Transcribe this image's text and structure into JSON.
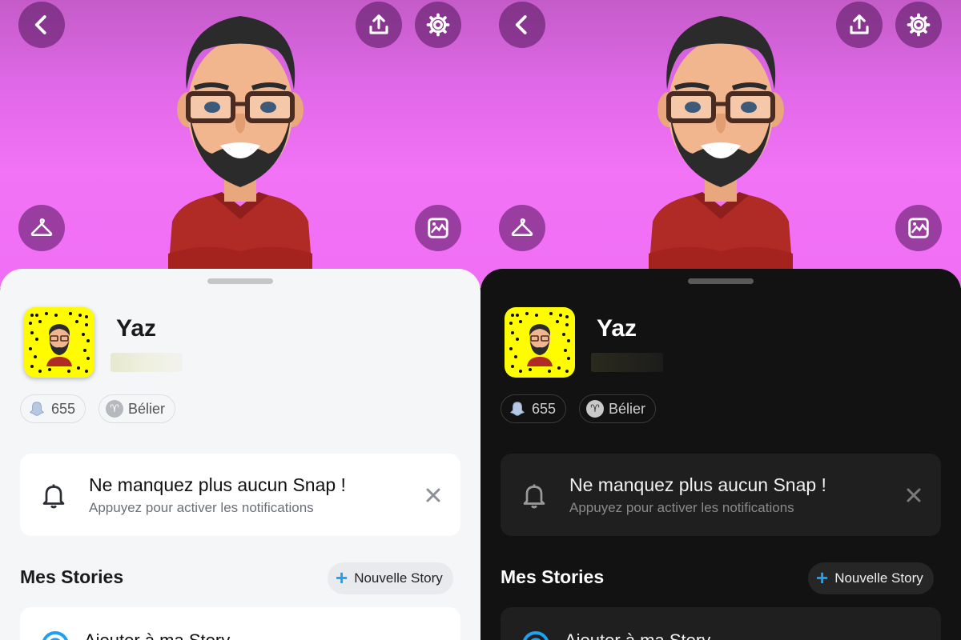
{
  "profile": {
    "display_name": "Yaz",
    "snap_score": "655",
    "zodiac": "Bélier",
    "zodiac_symbol": "♈"
  },
  "notification": {
    "title": "Ne manquez plus aucun Snap !",
    "subtitle": "Appuyez pour activer les notifications"
  },
  "stories": {
    "section_title": "Mes Stories",
    "new_story_label": "Nouvelle Story",
    "add_label": "Ajouter à ma Story"
  },
  "icons": {
    "back": "back-icon",
    "share": "share-icon",
    "settings": "gear-icon",
    "outfit": "hanger-icon",
    "background": "image-icon",
    "score": "ghost-icon",
    "bell": "bell-icon",
    "close": "close-icon",
    "add": "camera-plus-icon"
  },
  "colors": {
    "hero_background": "#f06ef4",
    "snapcode_yellow": "#fffc00",
    "accent_blue": "#1da1f2",
    "light_sheet": "#f5f6f8",
    "dark_sheet": "#121212"
  }
}
